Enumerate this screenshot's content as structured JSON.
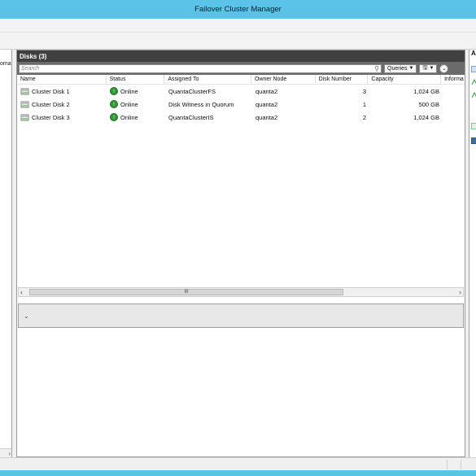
{
  "window": {
    "title": "Failover Cluster Manager"
  },
  "tree": {
    "fragment_text": "oma"
  },
  "disks_panel": {
    "title": "Disks (3)",
    "search_placeholder": "Search",
    "queries_label": "Queries",
    "columns": [
      "Name",
      "Status",
      "Assigned To",
      "Owner Node",
      "Disk Number",
      "Capacity",
      "Informa"
    ],
    "rows": [
      {
        "name": "Cluster Disk 1",
        "status": "Online",
        "assigned_to": "QuantaClusterFS",
        "owner_node": "quanta2",
        "disk_number": "3",
        "capacity": "1,024 GB"
      },
      {
        "name": "Cluster Disk 2",
        "status": "Online",
        "assigned_to": "Disk Witness in Quorum",
        "owner_node": "quanta2",
        "disk_number": "1",
        "capacity": "500 GB"
      },
      {
        "name": "Cluster Disk 3",
        "status": "Online",
        "assigned_to": "QuantaClusterIS",
        "owner_node": "quanta2",
        "disk_number": "2",
        "capacity": "1,024 GB"
      }
    ]
  },
  "actions_pane": {
    "header_fragment": "A"
  },
  "scrollbar": {
    "thumb_label": "III"
  },
  "colors": {
    "titlebar": "#5bc3e8",
    "panel_header": "#404040",
    "status_ok": "#2f9a2f"
  },
  "icons": {
    "disk": "disk-icon",
    "online": "online-check-icon",
    "search": "search-icon",
    "save": "save-icon",
    "expand": "chevron-down-icon"
  }
}
